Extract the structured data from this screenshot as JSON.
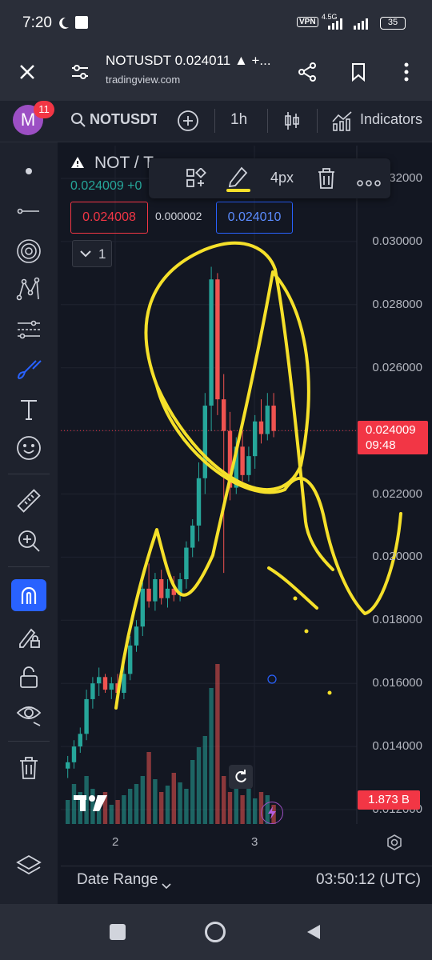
{
  "status_bar": {
    "time": "7:20",
    "vpn": "VPN",
    "network": "4.5G",
    "battery": "35"
  },
  "browser": {
    "title": "NOTUSDT 0.024011 ▲ +...",
    "url": "tradingview.com"
  },
  "app_bar": {
    "avatar_letter": "M",
    "notification_count": "11",
    "symbol": "NOTUSDT",
    "interval": "1h",
    "indicators_label": "Indicators"
  },
  "chart_header": {
    "pair": "NOT / Te",
    "price_change": "0.024009 +0",
    "bid": "0.024008",
    "spread": "0.000002",
    "ask": "0.024010",
    "collapse_count": "1"
  },
  "drawing_toolbar": {
    "width_label": "4px"
  },
  "price_axis": {
    "top_partial": "0.032000",
    "labels": [
      "0.030000",
      "0.028000",
      "0.026000",
      "0.022000",
      "0.020000",
      "0.018000",
      "0.016000",
      "0.014000",
      "0.012000"
    ],
    "current_price": "0.024009",
    "countdown": "09:48",
    "volume_label": "1.873 B"
  },
  "time_axis": {
    "labels": [
      "2",
      "3"
    ]
  },
  "footer": {
    "date_range": "Date Range",
    "clock": "03:50:12 (UTC)"
  },
  "colors": {
    "up": "#26a69a",
    "down": "#ef5350",
    "accent": "#2962ff",
    "drawing": "#f5e02a"
  },
  "chart_data": {
    "type": "candlestick",
    "ylim": [
      0.012,
      0.032
    ],
    "x_ticks": [
      "2",
      "3"
    ],
    "candles": [
      {
        "o": 0.0133,
        "h": 0.0137,
        "l": 0.013,
        "c": 0.0135
      },
      {
        "o": 0.0135,
        "h": 0.0142,
        "l": 0.0133,
        "c": 0.014
      },
      {
        "o": 0.014,
        "h": 0.0146,
        "l": 0.0138,
        "c": 0.0144
      },
      {
        "o": 0.0144,
        "h": 0.0158,
        "l": 0.0142,
        "c": 0.0155
      },
      {
        "o": 0.0155,
        "h": 0.0162,
        "l": 0.0152,
        "c": 0.016
      },
      {
        "o": 0.016,
        "h": 0.0165,
        "l": 0.0156,
        "c": 0.0162
      },
      {
        "o": 0.0162,
        "h": 0.0163,
        "l": 0.0157,
        "c": 0.0158
      },
      {
        "o": 0.0158,
        "h": 0.0162,
        "l": 0.0155,
        "c": 0.016
      },
      {
        "o": 0.016,
        "h": 0.0163,
        "l": 0.0156,
        "c": 0.0157
      },
      {
        "o": 0.0157,
        "h": 0.0166,
        "l": 0.0155,
        "c": 0.0163
      },
      {
        "o": 0.0163,
        "h": 0.0175,
        "l": 0.0161,
        "c": 0.0172
      },
      {
        "o": 0.0172,
        "h": 0.018,
        "l": 0.017,
        "c": 0.0178
      },
      {
        "o": 0.0178,
        "h": 0.0192,
        "l": 0.0175,
        "c": 0.019
      },
      {
        "o": 0.019,
        "h": 0.0198,
        "l": 0.0184,
        "c": 0.0186
      },
      {
        "o": 0.0186,
        "h": 0.0195,
        "l": 0.0183,
        "c": 0.0193
      },
      {
        "o": 0.0193,
        "h": 0.0196,
        "l": 0.0185,
        "c": 0.0187
      },
      {
        "o": 0.0187,
        "h": 0.0193,
        "l": 0.0184,
        "c": 0.019
      },
      {
        "o": 0.019,
        "h": 0.0194,
        "l": 0.0186,
        "c": 0.0188
      },
      {
        "o": 0.0188,
        "h": 0.0195,
        "l": 0.0186,
        "c": 0.0193
      },
      {
        "o": 0.0193,
        "h": 0.0205,
        "l": 0.019,
        "c": 0.0203
      },
      {
        "o": 0.0203,
        "h": 0.0212,
        "l": 0.02,
        "c": 0.021
      },
      {
        "o": 0.021,
        "h": 0.023,
        "l": 0.0205,
        "c": 0.0225
      },
      {
        "o": 0.0225,
        "h": 0.0252,
        "l": 0.022,
        "c": 0.0248
      },
      {
        "o": 0.0248,
        "h": 0.0292,
        "l": 0.024,
        "c": 0.0288
      },
      {
        "o": 0.0288,
        "h": 0.029,
        "l": 0.0245,
        "c": 0.025
      },
      {
        "o": 0.025,
        "h": 0.0258,
        "l": 0.0195,
        "c": 0.024
      },
      {
        "o": 0.024,
        "h": 0.0246,
        "l": 0.0218,
        "c": 0.0222
      },
      {
        "o": 0.0222,
        "h": 0.0238,
        "l": 0.022,
        "c": 0.0235
      },
      {
        "o": 0.0235,
        "h": 0.024,
        "l": 0.0224,
        "c": 0.0226
      },
      {
        "o": 0.0226,
        "h": 0.0235,
        "l": 0.0224,
        "c": 0.0232
      },
      {
        "o": 0.0232,
        "h": 0.0245,
        "l": 0.0228,
        "c": 0.0243
      },
      {
        "o": 0.0243,
        "h": 0.025,
        "l": 0.0236,
        "c": 0.0239
      },
      {
        "o": 0.0239,
        "h": 0.0252,
        "l": 0.0237,
        "c": 0.0248
      },
      {
        "o": 0.0248,
        "h": 0.0252,
        "l": 0.0238,
        "c": 0.024
      }
    ],
    "volume": [
      0.15,
      0.25,
      0.2,
      0.3,
      0.22,
      0.18,
      0.2,
      0.12,
      0.15,
      0.18,
      0.22,
      0.25,
      0.3,
      0.45,
      0.28,
      0.2,
      0.24,
      0.32,
      0.26,
      0.22,
      0.4,
      0.48,
      0.55,
      0.85,
      1.0,
      0.3,
      0.2,
      0.25,
      0.18,
      0.22,
      0.16,
      0.2,
      0.18,
      0.12
    ]
  }
}
